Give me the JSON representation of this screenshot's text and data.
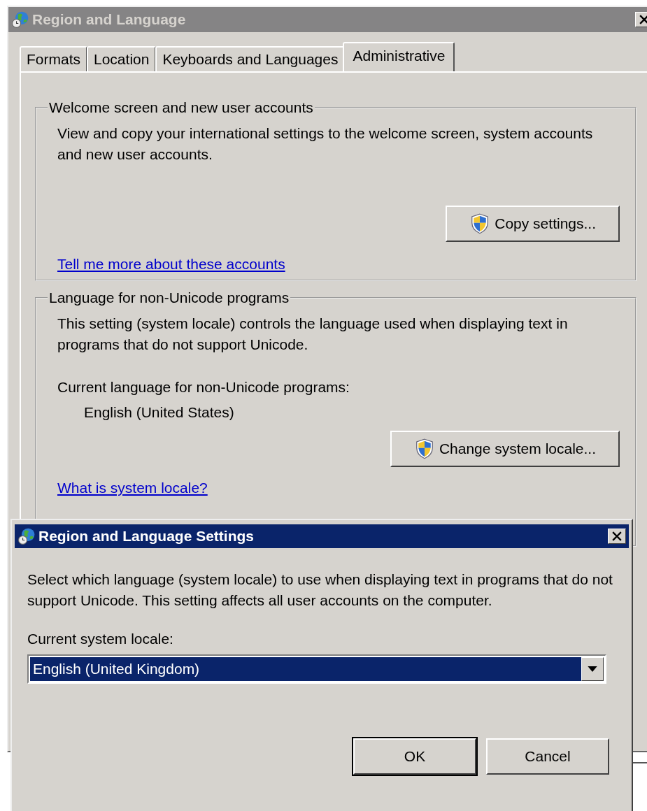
{
  "window": {
    "title": "Region and Language",
    "active": false
  },
  "tabs": [
    {
      "label": "Formats",
      "selected": false
    },
    {
      "label": "Location",
      "selected": false
    },
    {
      "label": "Keyboards and Languages",
      "selected": false
    },
    {
      "label": "Administrative",
      "selected": true
    }
  ],
  "groups": [
    {
      "title": "Welcome screen and new user accounts",
      "text": "View and copy your international settings to the welcome screen, system accounts and new user accounts.",
      "button": "Copy settings...",
      "link": "Tell me more about these accounts"
    },
    {
      "title": "Language for non-Unicode programs",
      "text": "This setting (system locale) controls the language used when displaying text in programs that do not support Unicode.",
      "current_label": "Current language for non-Unicode programs:",
      "current_value": "English (United States)",
      "button": "Change system locale...",
      "link": "What is system locale?"
    }
  ],
  "dialog": {
    "title": "Region and Language Settings",
    "active": true,
    "text": "Select which language (system locale) to use when displaying text in programs that do not support Unicode. This setting affects all user accounts on the computer.",
    "field_label": "Current system locale:",
    "dropdown": {
      "value": "English (United Kingdom)"
    },
    "buttons": [
      {
        "label": "OK",
        "default": true
      },
      {
        "label": "Cancel",
        "default": false
      }
    ]
  }
}
